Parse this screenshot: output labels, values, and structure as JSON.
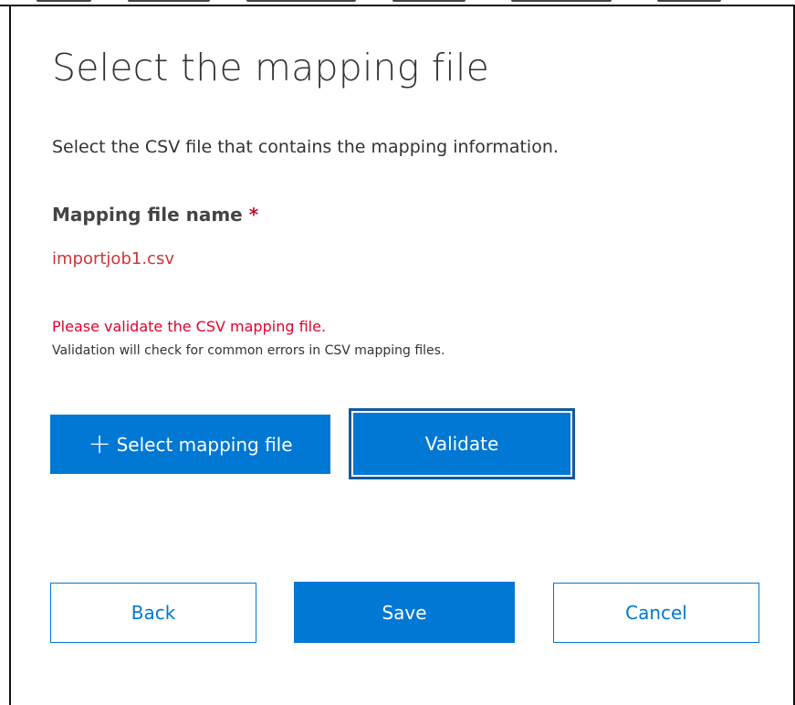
{
  "dialog": {
    "title": "Select the mapping file",
    "description": "Select the CSV file that contains the mapping information."
  },
  "mapping_field": {
    "label": "Mapping file name",
    "required_marker": "*",
    "value": "importjob1.csv"
  },
  "validation": {
    "error_message": "Please validate the CSV mapping file.",
    "help_text": "Validation will check for common errors in CSV mapping files."
  },
  "actions": {
    "select_icon": "plus-icon",
    "select_icon_glyph": "+",
    "select_label": "Select mapping file",
    "validate_label": "Validate"
  },
  "footer": {
    "back_label": "Back",
    "save_label": "Save",
    "cancel_label": "Cancel"
  },
  "colors": {
    "accent": "#0078d4",
    "error": "#e3002b",
    "focus_border": "#0f5a9c",
    "text": "#333333"
  }
}
